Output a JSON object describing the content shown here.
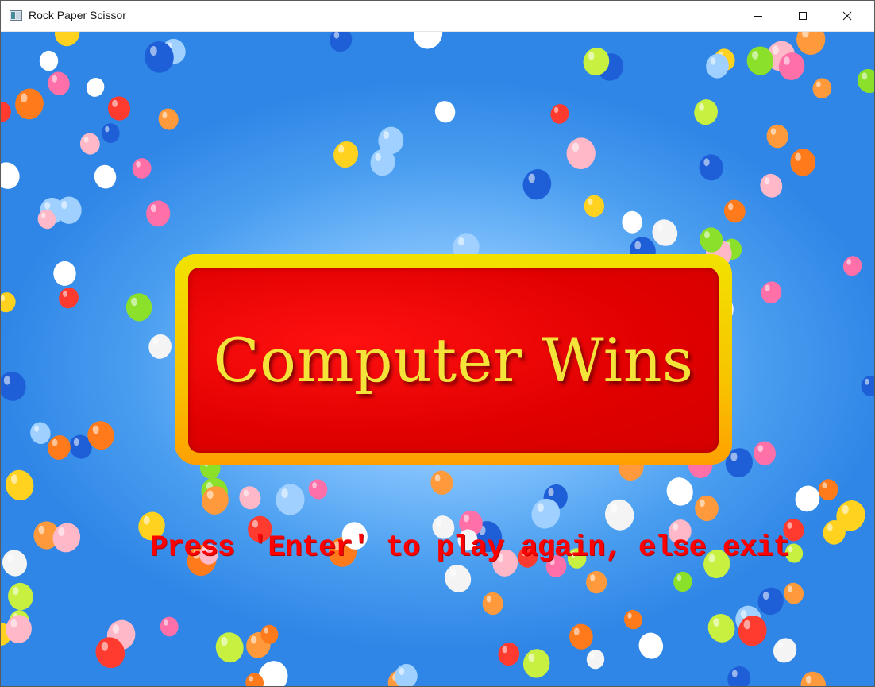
{
  "window": {
    "title": "Rock Paper Scissor",
    "controls": [
      "minimize-icon",
      "maximize-icon",
      "close-icon"
    ]
  },
  "game": {
    "result_text": "Computer Wins",
    "prompt_text": "Press 'Enter' to play again, else exit",
    "background": "balloons-on-blue-sky"
  },
  "colors": {
    "sky": "#2f86e6",
    "banner_border": "#f5cc00",
    "banner_fill": "#e00000",
    "result_text": "#f4e43a",
    "prompt_text": "#ff0000"
  }
}
